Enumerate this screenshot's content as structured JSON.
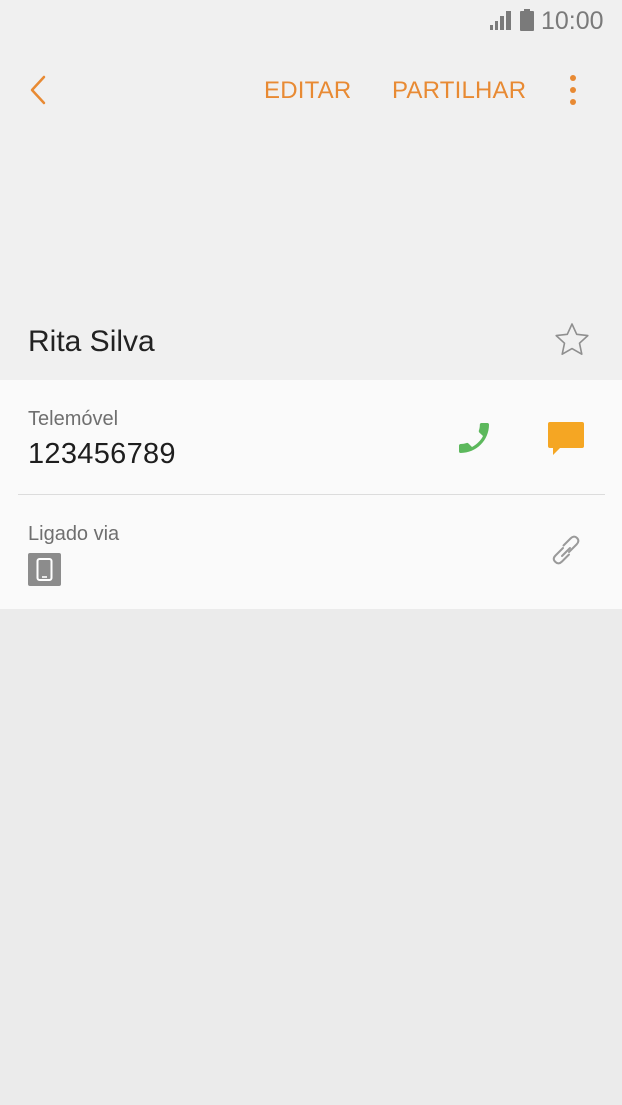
{
  "status_bar": {
    "time": "10:00",
    "signal_icon": "signal-icon",
    "battery_icon": "battery-icon"
  },
  "toolbar": {
    "back_icon": "chevron-left-icon",
    "edit_label": "EDITAR",
    "share_label": "PARTILHAR",
    "more_icon": "more-vertical-icon"
  },
  "contact": {
    "name": "Rita Silva",
    "favorite_icon": "star-outline-icon"
  },
  "phone": {
    "label": "Telemóvel",
    "number": "123456789",
    "call_icon": "phone-icon",
    "message_icon": "message-icon"
  },
  "linked": {
    "label": "Ligado via",
    "device_icon": "device-icon",
    "link_icon": "link-icon"
  },
  "colors": {
    "accent": "#e88a33",
    "call_green": "#5cb85c",
    "message_orange": "#f5a623"
  }
}
